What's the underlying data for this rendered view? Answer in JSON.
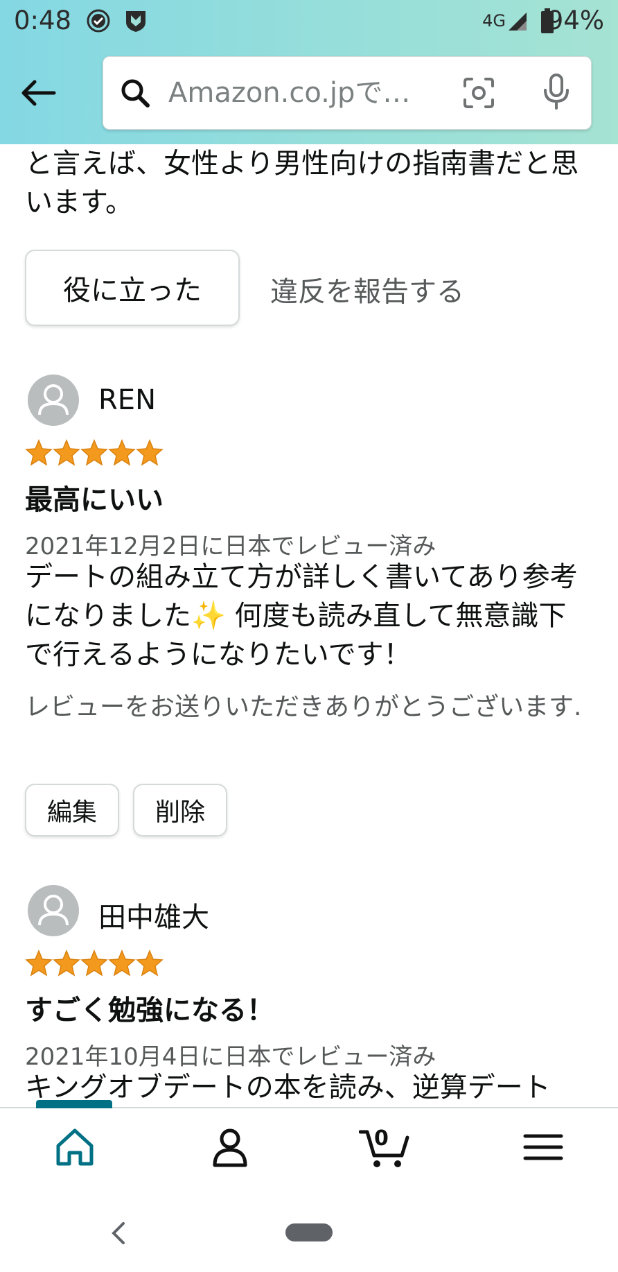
{
  "status_bar": {
    "time": "0:48",
    "network": "4G",
    "battery": "94%"
  },
  "search": {
    "placeholder": "Amazon.co.jpで…"
  },
  "intro": {
    "text": "と言えば、女性より男性向けの指南書だと思います。"
  },
  "actions": {
    "helpful": "役に立った",
    "report": "違反を報告する"
  },
  "reviews": [
    {
      "reviewer": "REN",
      "rating": 5,
      "title": "最高にいい",
      "date": "2021年12月2日に日本でレビュー済み",
      "body": "デートの組み立て方が詳しく書いてあり参考になりました✨ 何度も読み直して無意識下で行えるようになりたいです！",
      "thanks": "レビューをお送りいただきありがとうございます.",
      "edit_label": "編集",
      "delete_label": "削除"
    },
    {
      "reviewer": "田中雄大",
      "rating": 5,
      "title": "すごく勉強になる！",
      "date": "2021年10月4日に日本でレビュー済み",
      "body": "キングオブデートの本を読み、逆算デート"
    }
  ],
  "bottom_nav": {
    "cart_count": "0"
  },
  "colors": {
    "header_gradient": [
      "#84d8e3",
      "#a5e3d3"
    ],
    "star": "#f39a1e",
    "accent": "#007185"
  }
}
